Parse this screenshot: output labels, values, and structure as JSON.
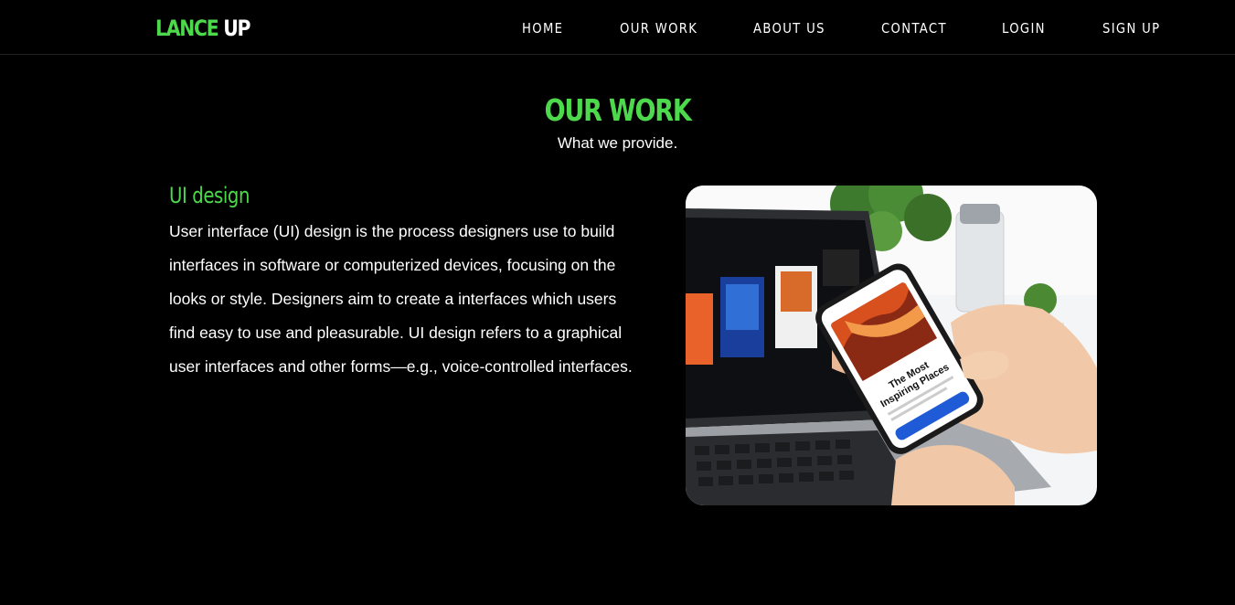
{
  "brand": {
    "part1": "LANCE",
    "part2": "UP"
  },
  "nav": [
    {
      "label": "HOME",
      "key": "home"
    },
    {
      "label": "OUR WORK",
      "key": "our-work"
    },
    {
      "label": "ABOUT US",
      "key": "about-us"
    },
    {
      "label": "CONTACT",
      "key": "contact"
    },
    {
      "label": "LOGIN",
      "key": "login"
    },
    {
      "label": "SIGN UP",
      "key": "sign-up"
    }
  ],
  "section": {
    "title": "OUR WORK",
    "subtitle": "What we provide."
  },
  "card": {
    "title": "UI design",
    "description": "User interface (UI) design is the process designers use to build interfaces in software or computerized devices, focusing on the looks or style. Designers aim to create a interfaces which users find easy to use and pleasurable. UI design refers to a graphical user interfaces and other forms—e.g., voice-controlled interfaces.",
    "image": {
      "icon": "laptop-phone-photo",
      "phone_heading_line1": "The Most",
      "phone_heading_line2": "Inspiring Places"
    }
  },
  "colors": {
    "background": "#000000",
    "accent": "#4cd94c",
    "text": "#ffffff"
  }
}
